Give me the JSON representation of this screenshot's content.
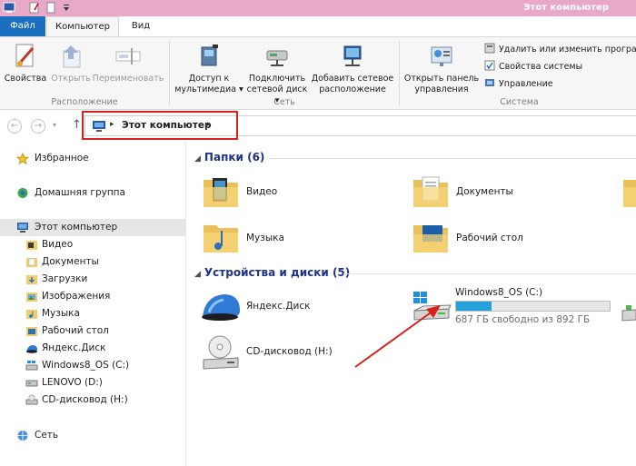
{
  "window": {
    "title": "Этот компьютер"
  },
  "ribbon_tabs": {
    "file": "Файл",
    "computer": "Компьютер",
    "view": "Вид"
  },
  "ribbon": {
    "properties": "Свойства",
    "open": "Открыть",
    "rename": "Переименовать",
    "media_access": [
      "Доступ к",
      "мультимедиа"
    ],
    "map_drive": [
      "Подключить",
      "сетевой диск"
    ],
    "add_network_location": [
      "Добавить сетевое",
      "расположение"
    ],
    "open_control_panel": [
      "Открыть панель",
      "управления"
    ],
    "uninstall": "Удалить или изменить програм",
    "system_properties": "Свойства системы",
    "manage": "Управление",
    "group_location": "Расположение",
    "group_network": "Сеть",
    "group_system": "Система"
  },
  "address": {
    "path": "Этот компьютер"
  },
  "nav": {
    "favorites": "Избранное",
    "homegroup": "Домашняя группа",
    "this_pc": "Этот компьютер",
    "items": [
      "Видео",
      "Документы",
      "Загрузки",
      "Изображения",
      "Музыка",
      "Рабочий стол",
      "Яндекс.Диск",
      "Windows8_OS (C:)",
      "LENOVO (D:)",
      "CD-дисковод (H:)"
    ],
    "network": "Сеть"
  },
  "content": {
    "folders_header": "Папки (6)",
    "folders": [
      "Видео",
      "Документы",
      "Музыка",
      "Рабочий стол"
    ],
    "devices_header": "Устройства и диски (5)",
    "devices": {
      "yandex": "Яндекс.Диск",
      "c_drive_name": "Windows8_OS (C:)",
      "c_drive_free": "687 ГБ свободно из 892 ГБ",
      "c_drive_used_fraction": 0.23,
      "cd_drive": "CD-дисковод (H:)"
    }
  },
  "colors": {
    "file_tab": "#1b6fc0",
    "titlebar": "#e8a9c8",
    "section_header": "#1e3287",
    "highlight": "#d8231c",
    "drive_bar": "#26a0da"
  }
}
